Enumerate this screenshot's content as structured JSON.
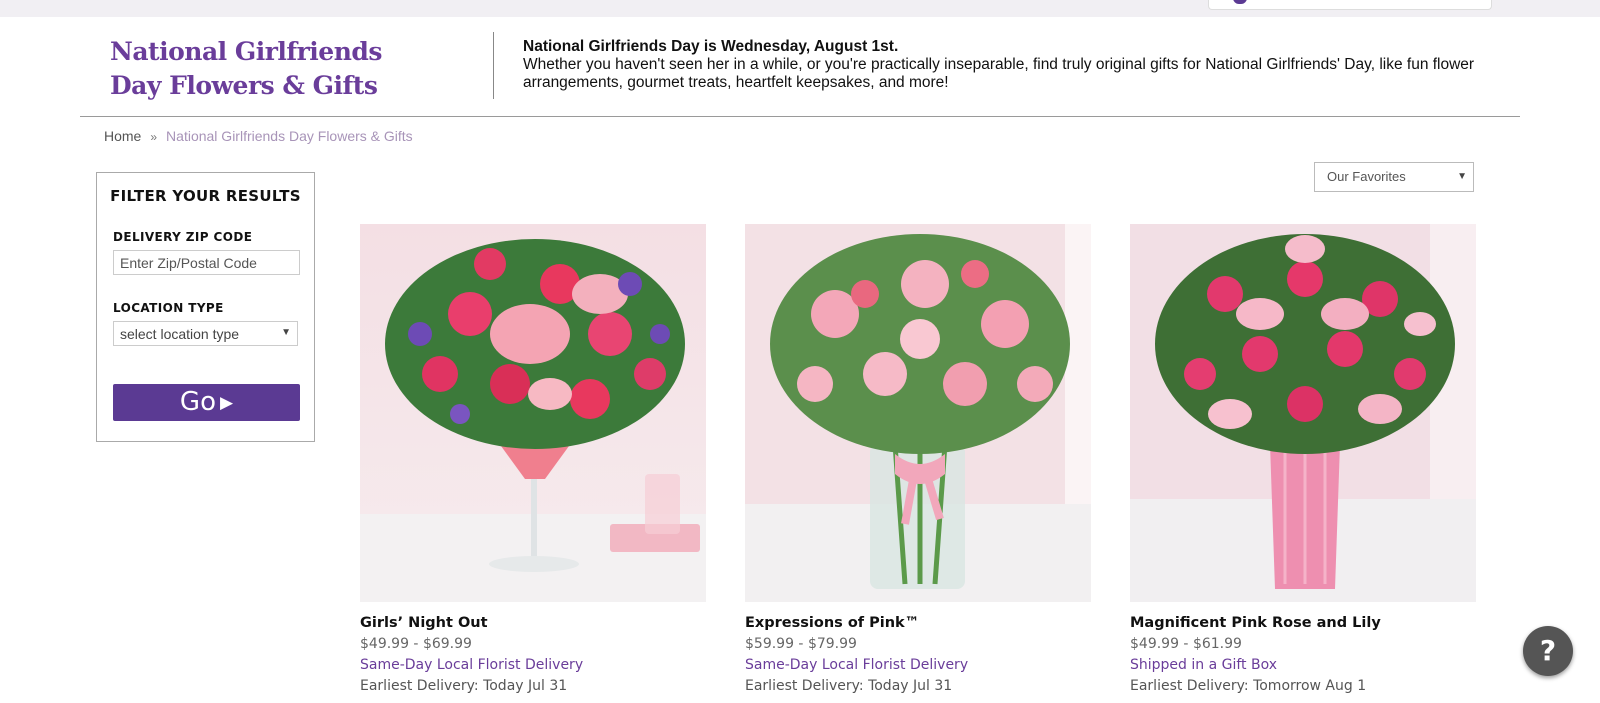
{
  "header": {
    "title": "National Girlfriends Day Flowers & Gifts",
    "intro_heading": "National Girlfriends Day is Wednesday, August 1st.",
    "intro_text": "Whether you haven't seen her in a while, or you're practically inseparable, find truly original gifts for National Girlfriends' Day, like fun flower arrangements, gourmet treats, heartfelt keepsakes, and more!"
  },
  "breadcrumb": {
    "home": "Home",
    "separator": "»",
    "current": "National Girlfriends Day Flowers & Gifts"
  },
  "filter": {
    "title": "FILTER YOUR RESULTS",
    "zip_label": "DELIVERY ZIP CODE",
    "zip_placeholder": "Enter Zip/Postal Code",
    "zip_value": "",
    "location_label": "LOCATION TYPE",
    "location_selected": "select location type",
    "go_label": "Go",
    "go_icon": "play-triangle-icon"
  },
  "sort": {
    "selected": "Our Favorites",
    "icon": "chevron-down-icon"
  },
  "products": [
    {
      "name": "Girls’ Night Out",
      "price": "$49.99 - $69.99",
      "delivery_type": "Same-Day Local Florist Delivery",
      "earliest": "Earliest Delivery: Today Jul 31"
    },
    {
      "name": "Expressions of Pink™",
      "price": "$59.99 - $79.99",
      "delivery_type": "Same-Day Local Florist Delivery",
      "earliest": "Earliest Delivery: Today Jul 31"
    },
    {
      "name": "Magnificent Pink Rose and Lily",
      "price": "$49.99 - $61.99",
      "delivery_type": "Shipped in a Gift Box",
      "earliest": "Earliest Delivery: Tomorrow Aug 1"
    }
  ],
  "help": {
    "label": "?",
    "icon": "help-icon"
  },
  "colors": {
    "brand_purple": "#6a3d9a",
    "button_purple": "#5b3a93",
    "top_strip": "#f1eff3"
  }
}
